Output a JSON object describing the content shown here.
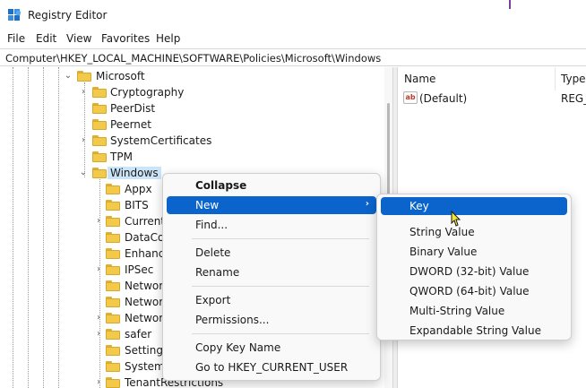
{
  "window": {
    "title": "Registry Editor"
  },
  "menu": [
    "File",
    "Edit",
    "View",
    "Favorites",
    "Help"
  ],
  "address": "Computer\\HKEY_LOCAL_MACHINE\\SOFTWARE\\Policies\\Microsoft\\Windows",
  "tree": {
    "microsoft": "Microsoft",
    "children": [
      "Cryptography",
      "PeerDist",
      "Peernet",
      "SystemCertificates",
      "TPM",
      "Windows"
    ],
    "windows_children": [
      "Appx",
      "BITS",
      "Current",
      "DataCo",
      "Enhanc",
      "IPSec",
      "Networ",
      "Networ",
      "Networ",
      "safer",
      "SettingS",
      "System",
      "TenantRestrictions"
    ]
  },
  "values_pane": {
    "col_name": "Name",
    "col_type": "Type",
    "rows": [
      {
        "name": "(Default)",
        "type": "REG_"
      }
    ]
  },
  "context_menu": {
    "items": [
      "Collapse",
      "New",
      "Find...",
      "Delete",
      "Rename",
      "Export",
      "Permissions...",
      "Copy Key Name",
      "Go to HKEY_CURRENT_USER"
    ]
  },
  "submenu": {
    "items": [
      "Key",
      "String Value",
      "Binary Value",
      "DWORD (32-bit) Value",
      "QWORD (64-bit) Value",
      "Multi-String Value",
      "Expandable String Value"
    ]
  },
  "colors": {
    "highlight": "#0a64cc",
    "selection": "#cce4f7",
    "folder": "#f3c94a"
  }
}
